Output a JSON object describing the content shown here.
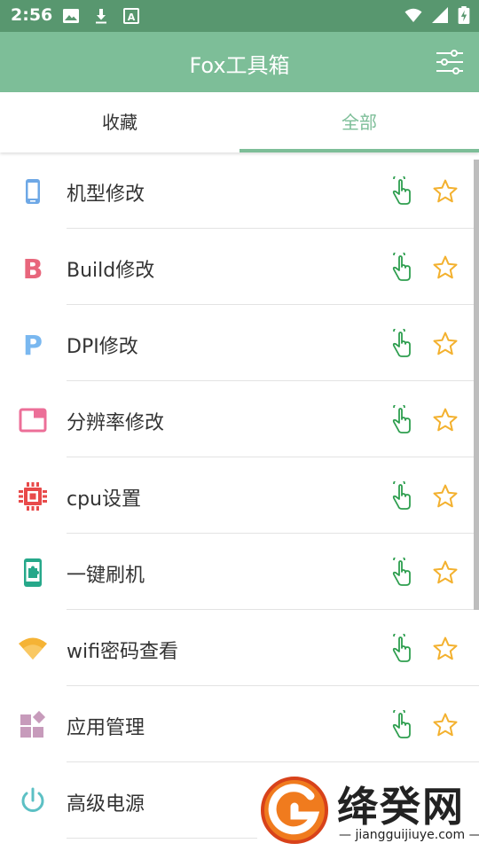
{
  "status_bar": {
    "time": "2:56",
    "icons_left": [
      "image-icon",
      "download-icon",
      "a-box-icon"
    ],
    "icons_right": [
      "wifi-icon",
      "signal-icon",
      "battery-charging-icon"
    ]
  },
  "app_bar": {
    "title": "Fox工具箱",
    "action_icon": "sliders-icon",
    "color": "#7dbe98"
  },
  "tabs": [
    {
      "label": "收藏",
      "selected": false
    },
    {
      "label": "全部",
      "selected": true
    }
  ],
  "items": [
    {
      "label": "机型修改",
      "icon": "phone-icon",
      "icon_color": "#6ea8e6"
    },
    {
      "label": "Build修改",
      "icon": "letter-b-icon",
      "icon_color": "#e8667c"
    },
    {
      "label": "DPI修改",
      "icon": "letter-p-icon",
      "icon_color": "#7ab8f0"
    },
    {
      "label": "分辨率修改",
      "icon": "window-icon",
      "icon_color": "#ec6f98"
    },
    {
      "label": "cpu设置",
      "icon": "chip-icon",
      "icon_color": "#e84a4a"
    },
    {
      "label": "一键刷机",
      "icon": "phone-puzzle-icon",
      "icon_color": "#26a88a"
    },
    {
      "label": "wifi密码查看",
      "icon": "wifi-fan-icon",
      "icon_color": "#f5b335"
    },
    {
      "label": "应用管理",
      "icon": "apps-icon",
      "icon_color": "#c79bbb"
    },
    {
      "label": "高级电源",
      "icon": "power-icon",
      "icon_color": "#5cc0c4"
    }
  ],
  "item_actions": {
    "touch_icon": "touch-hand-icon",
    "touch_color": "#2e9e4f",
    "star_icon": "star-outline-icon",
    "star_color": "#f3b12f"
  },
  "watermark": {
    "text": "绛癸网",
    "url": "— jiangguijiuye.com —"
  }
}
